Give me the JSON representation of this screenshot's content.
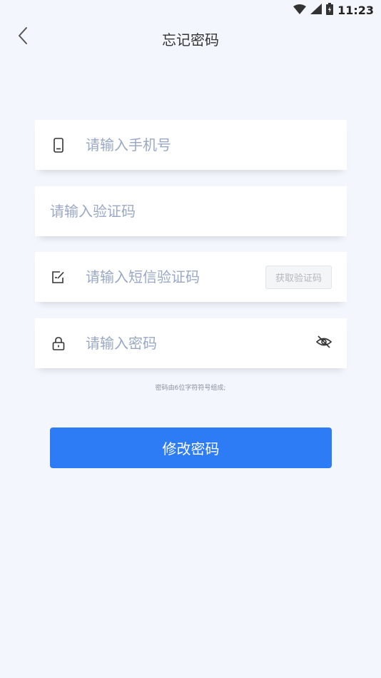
{
  "status_bar": {
    "time": "11:23",
    "icons": [
      "wifi-icon",
      "cell-signal-icon",
      "battery-icon"
    ]
  },
  "header": {
    "title": "忘记密码",
    "back_icon": "chevron-left-icon"
  },
  "form": {
    "phone_placeholder": "请输入手机号",
    "code_placeholder": "请输入验证码",
    "sms_placeholder": "请输入短信验证码",
    "sms_button_label": "获取验证码",
    "password_placeholder": "请输入密码",
    "password_hint": "密码由6位字符符号组成;",
    "submit_label": "修改密码"
  },
  "colors": {
    "background": "#f3f7fd",
    "primary": "#2d7cf6",
    "placeholder": "#9aa8c6"
  }
}
